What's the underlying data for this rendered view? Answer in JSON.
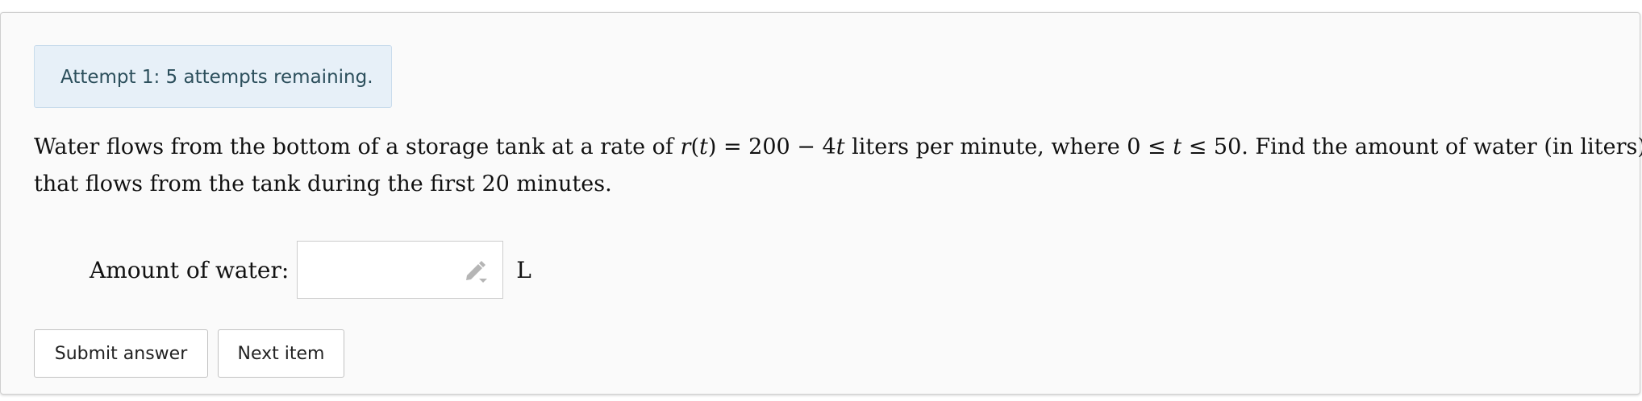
{
  "alert": {
    "text": "Attempt 1: 5 attempts remaining."
  },
  "question": {
    "line1_before": "Water flows from the bottom of a storage tank at a rate of ",
    "rate_fn": "r",
    "rate_var_open": "(",
    "rate_var": "t",
    "rate_var_close": ")",
    "rate_expr": " = 200 − 4",
    "rate_expr_var": "t",
    "line1_mid": " liters per minute, where ",
    "domain_start": "0 ≤ ",
    "domain_var": "t",
    "domain_end": " ≤ 50",
    "line1_after": ". Find the amount of water (in liters)",
    "line2": "that flows from the tank during the first 20 minutes."
  },
  "answer": {
    "label": "Amount of water:",
    "value": "",
    "unit": "L",
    "input_icon": "pencil-dropdown-icon"
  },
  "buttons": {
    "submit_label": "Submit answer",
    "next_label": "Next item"
  },
  "colors": {
    "alert_bg": "#e7f0f8",
    "alert_text": "#2c4f5c",
    "card_bg": "#fafafa"
  }
}
